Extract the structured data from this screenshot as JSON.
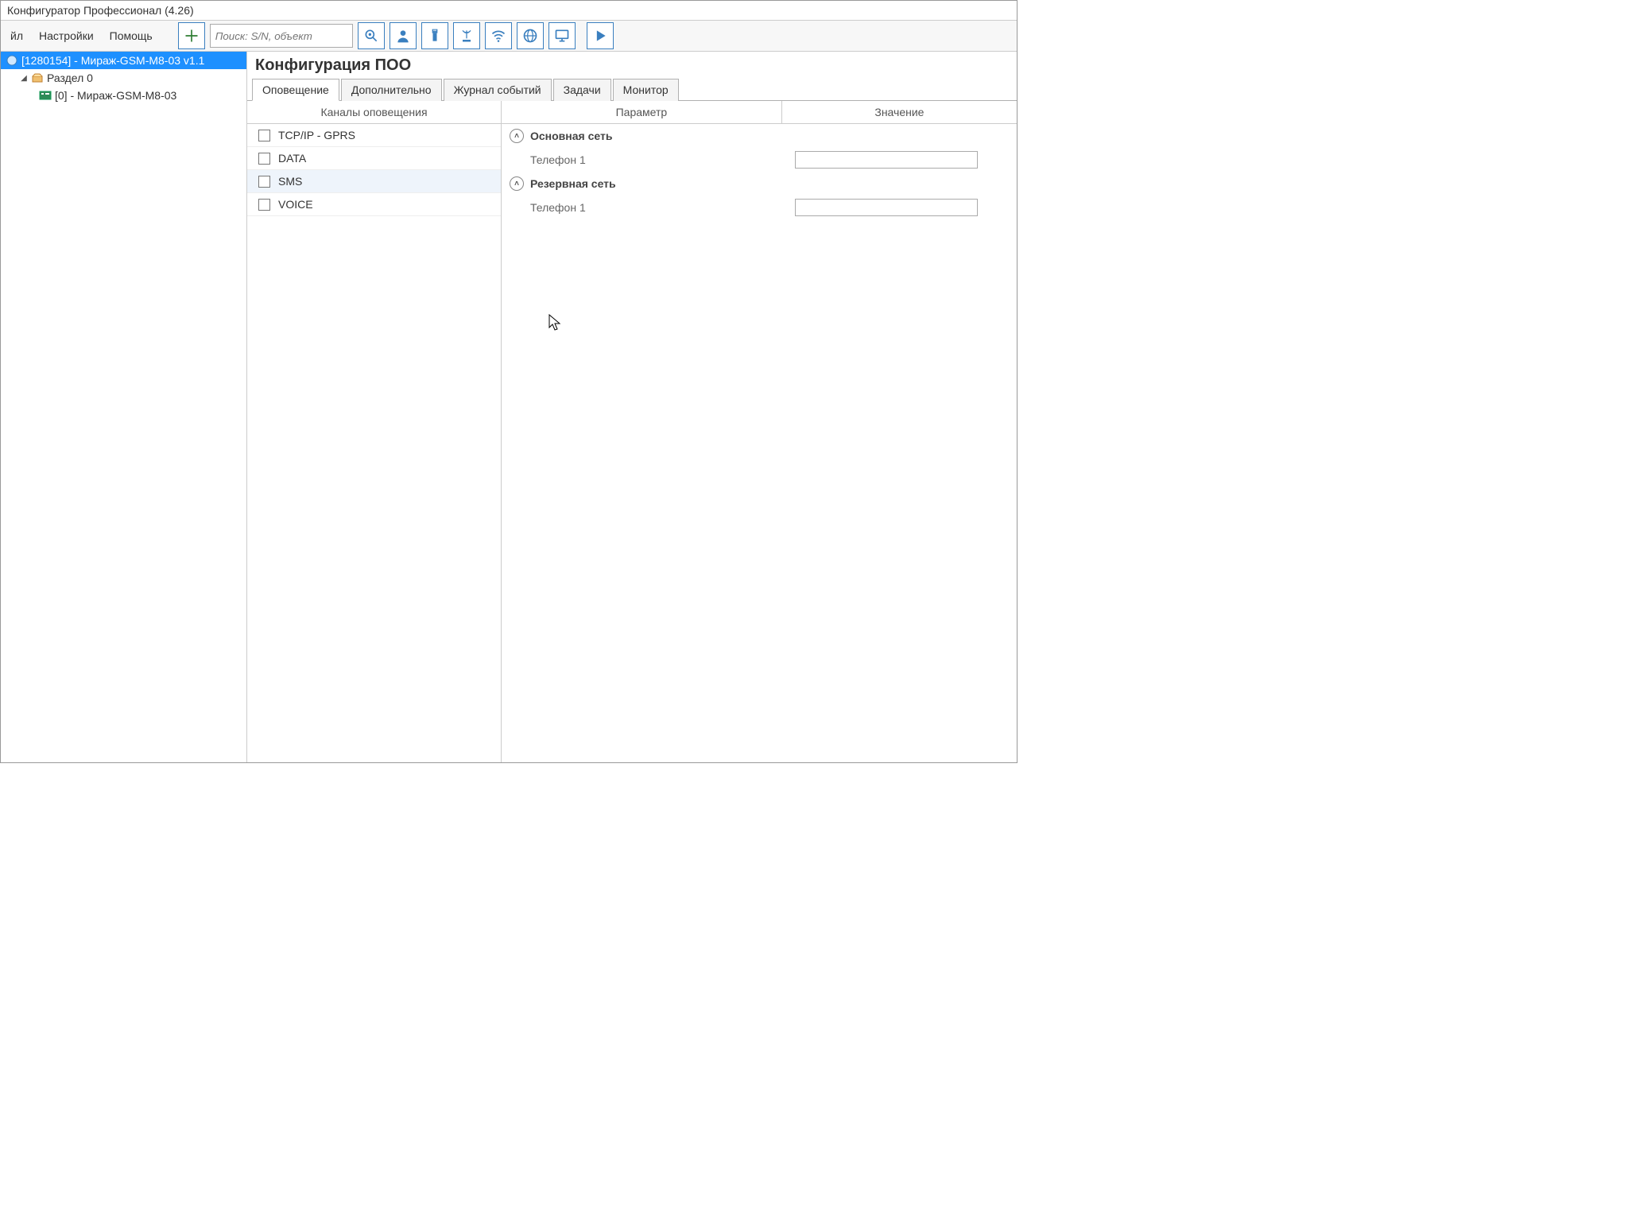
{
  "window": {
    "title": "Конфигуратор Профессионал (4.26)"
  },
  "menu": {
    "file": "йл",
    "settings": "Настройки",
    "help": "Помощь"
  },
  "toolbar": {
    "search_placeholder": "Поиск: S/N, объект"
  },
  "tree": {
    "device": "[1280154] - Мираж-GSM-M8-03  v1.1",
    "section": "Раздел 0",
    "child": "[0] - Мираж-GSM-M8-03"
  },
  "main": {
    "title": "Конфигурация ПОО",
    "tabs": {
      "notify": "Оповещение",
      "extra": "Дополнительно",
      "journal": "Журнал событий",
      "tasks": "Задачи",
      "monitor": "Монитор"
    }
  },
  "channels": {
    "header": "Каналы оповещения",
    "items": [
      "TCP/IP - GPRS",
      "DATA",
      "SMS",
      "VOICE"
    ]
  },
  "params": {
    "col_param": "Параметр",
    "col_value": "Значение",
    "group1": "Основная сеть",
    "g1_phone": "Телефон 1",
    "g1_phone_val": "",
    "group2": "Резервная сеть",
    "g2_phone": "Телефон 1",
    "g2_phone_val": ""
  }
}
